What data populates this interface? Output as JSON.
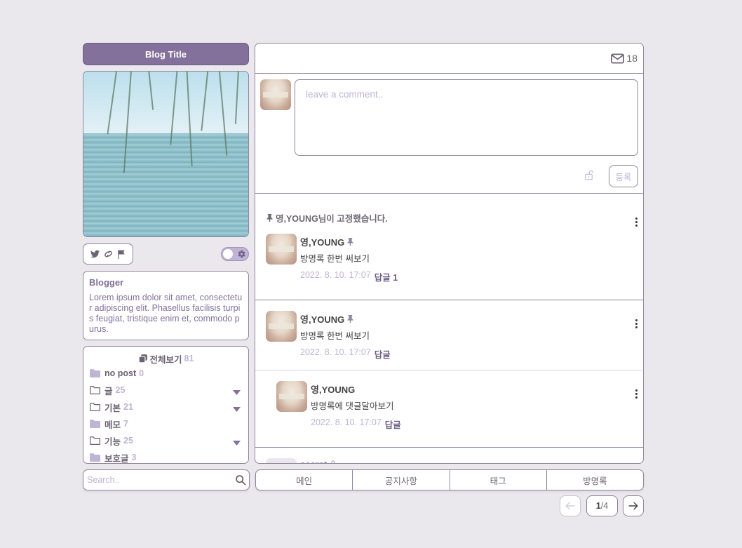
{
  "blog": {
    "title": "Blog Title"
  },
  "profile": {
    "name": "Blogger",
    "bio": "Lorem ipsum dolor sit amet, consectetur adipiscing elit. Phasellus facilisis turpis feugiat, tristique enim et, commodo purus."
  },
  "social": {
    "icons": [
      "twitter-icon",
      "link-icon",
      "flag-icon"
    ]
  },
  "theme_toggle": {
    "state": "off",
    "icon": "gear-icon"
  },
  "categories": {
    "all": {
      "label": "전체보기",
      "count": "81"
    },
    "items": [
      {
        "label": "no post",
        "count": "0",
        "icon": "folder-filled-icon",
        "expandable": false
      },
      {
        "label": "글",
        "count": "25",
        "icon": "folder-outline-icon",
        "expandable": true
      },
      {
        "label": "기본",
        "count": "21",
        "icon": "folder-outline-icon",
        "expandable": true
      },
      {
        "label": "메모",
        "count": "7",
        "icon": "folder-filled-icon",
        "expandable": false
      },
      {
        "label": "기능",
        "count": "25",
        "icon": "folder-outline-icon",
        "expandable": true
      },
      {
        "label": "보호글",
        "count": "3",
        "icon": "folder-filled-icon",
        "expandable": false
      }
    ]
  },
  "search": {
    "placeholder": "Search.."
  },
  "header": {
    "mail_count": "18"
  },
  "compose": {
    "placeholder": "leave a comment..",
    "submit_label": "등록"
  },
  "pinned_notice": "영,YOUNG님이 고정했습니다.",
  "comments": [
    {
      "author": "영,YOUNG",
      "pinned": true,
      "text": "방명록 한번 써보기",
      "date": "2022. 8. 10. 17:07",
      "reply_label": "답글",
      "reply_count": "1"
    },
    {
      "author": "영,YOUNG",
      "pinned": true,
      "text": "방명록 한번 써보기",
      "date": "2022. 8. 10. 17:07",
      "reply_label": "답글"
    },
    {
      "author": "영,YOUNG",
      "pinned": false,
      "is_reply": true,
      "text": "방명록에 댓글달아보기",
      "date": "2022. 8. 10. 17:07",
      "reply_label": "답글"
    },
    {
      "author": "secret",
      "pinned": false,
      "locked": true
    }
  ],
  "nav": {
    "tabs": [
      "메인",
      "공지사항",
      "태그",
      "방명록"
    ]
  },
  "pagination": {
    "current": "1",
    "total": "4"
  },
  "colors": {
    "accent": "#83709b",
    "muted": "#bfb4d6",
    "border": "#8f85a0",
    "background": "#eae8ec"
  }
}
